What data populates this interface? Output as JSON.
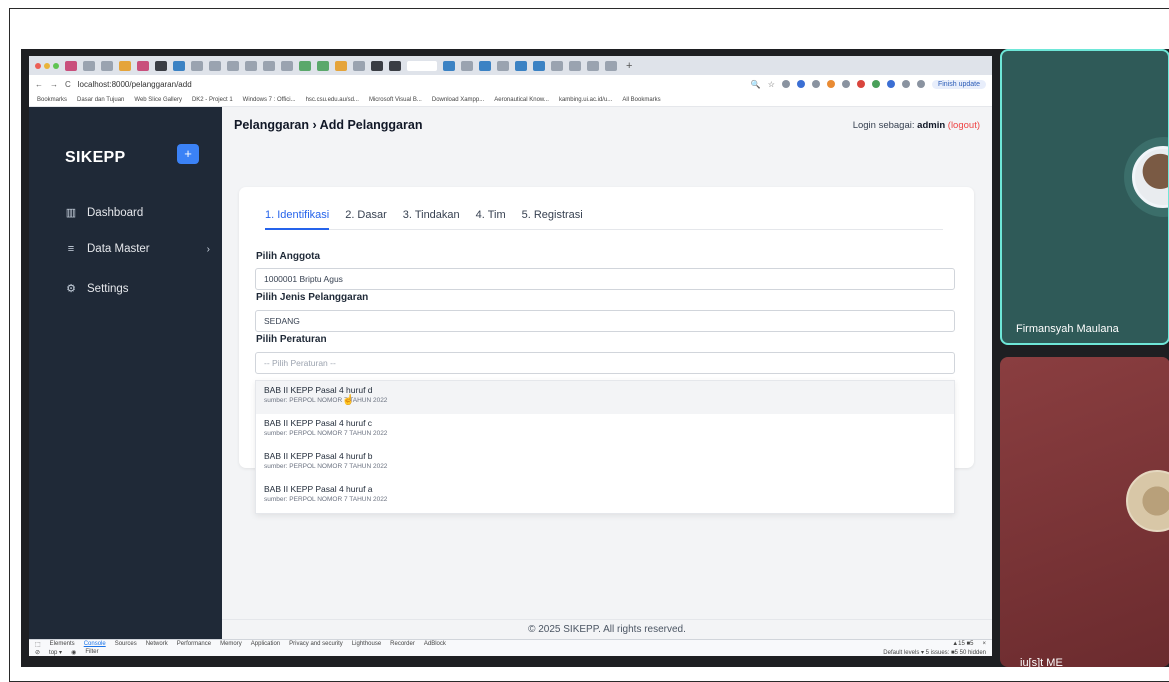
{
  "browser": {
    "url": "localhost:8000/pelanggaran/add",
    "finish_update": "Finish update",
    "bookmarks": [
      "Bookmarks",
      "Dasar dan Tujuan",
      "Web Slice Gallery",
      "DK2 - Project 1",
      "Windows 7 : Offici...",
      "hsc.csu.edu.au/sd...",
      "Microsoft Visual B...",
      "Download Xampp...",
      "Aeronautical Know...",
      "kambing.ui.ac.id/u...",
      "All Bookmarks"
    ]
  },
  "sidebar": {
    "brand": "SIKEPP",
    "add_label": "+",
    "items": [
      {
        "label": "Dashboard",
        "icon": "bar-chart-icon"
      },
      {
        "label": "Data Master",
        "icon": "menu-icon"
      },
      {
        "label": "Settings",
        "icon": "gear-icon"
      }
    ]
  },
  "header": {
    "title": "Pelanggaran › Add Pelanggaran",
    "login_prefix": "Login sebagai:",
    "user": "admin",
    "logout": "(logout)"
  },
  "form": {
    "tabs": [
      "1. Identifikasi",
      "2. Dasar",
      "3. Tindakan",
      "4. Tim",
      "5. Registrasi"
    ],
    "anggota_label": "Pilih Anggota",
    "anggota_value": "1000001 Briptu Agus",
    "jenis_label": "Pilih Jenis Pelanggaran",
    "jenis_value": "SEDANG",
    "peraturan_label": "Pilih Peraturan",
    "peraturan_placeholder": "-- Pilih Peraturan --",
    "options": [
      {
        "title": "BAB II KEPP Pasal 4 huruf d",
        "source": "sumber: PERPOL NOMOR 7 TAHUN 2022"
      },
      {
        "title": "BAB II KEPP Pasal 4 huruf c",
        "source": "sumber: PERPOL NOMOR 7 TAHUN 2022"
      },
      {
        "title": "BAB II KEPP Pasal 4 huruf b",
        "source": "sumber: PERPOL NOMOR 7 TAHUN 2022"
      },
      {
        "title": "BAB II KEPP Pasal 4 huruf a",
        "source": "sumber: PERPOL NOMOR 7 TAHUN 2022"
      }
    ]
  },
  "footer": "© 2025 SIKEPP. All rights reserved.",
  "devtools": {
    "tabs": [
      "Elements",
      "Console",
      "Sources",
      "Network",
      "Performance",
      "Memory",
      "Application",
      "Privacy and security",
      "Lighthouse",
      "Recorder",
      "AdBlock"
    ],
    "context": "top ▾",
    "filter": "Filter",
    "status": "▲15 ■5",
    "levels": "Default levels ▾   5 issues: ■5   50 hidden"
  },
  "participants": [
    {
      "name": "Firmansyah Maulana"
    },
    {
      "name": "iu[s]t ME"
    }
  ],
  "colors": {
    "accent": "#2563eb",
    "sidebar": "#1f2937",
    "logout": "#ef4444",
    "participant_border": "#6ee7d8"
  }
}
